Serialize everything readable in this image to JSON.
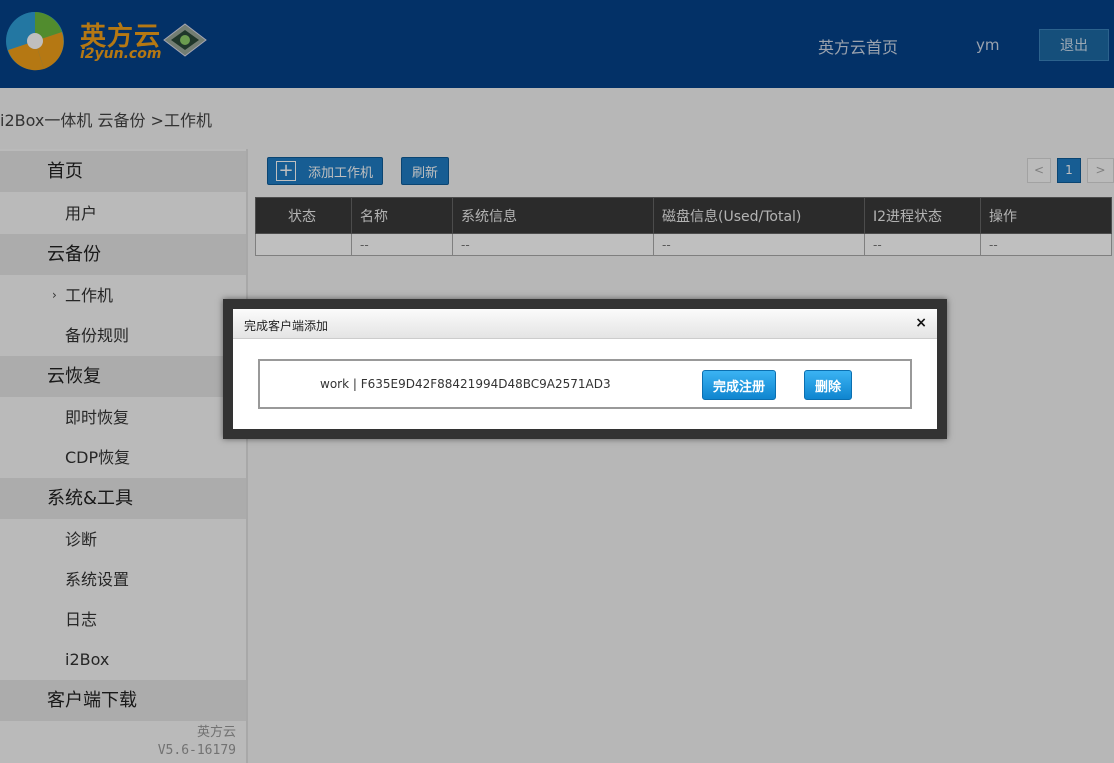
{
  "header": {
    "logo_text": "英方云",
    "logo_sub": "i2yun.com",
    "nav_home": "英方云首页",
    "user": "ym",
    "logout": "退出"
  },
  "breadcrumb": "i2Box一体机 云备份 >工作机",
  "sidebar": {
    "items": [
      {
        "label": "首页"
      },
      {
        "label": "用户"
      },
      {
        "label": "云备份"
      },
      {
        "label": "工作机"
      },
      {
        "label": "备份规则"
      },
      {
        "label": "云恢复"
      },
      {
        "label": "即时恢复"
      },
      {
        "label": "CDP恢复"
      },
      {
        "label": "系统&工具"
      },
      {
        "label": "诊断"
      },
      {
        "label": "系统设置"
      },
      {
        "label": "日志"
      },
      {
        "label": "i2Box"
      },
      {
        "label": "客户端下载"
      }
    ],
    "footer_brand": "英方云",
    "footer_version": "V5.6-16179"
  },
  "toolbar": {
    "add": "添加工作机",
    "refresh": "刷新"
  },
  "pager": {
    "prev": "<",
    "current": "1",
    "next": ">"
  },
  "table": {
    "headers": [
      "状态",
      "名称",
      "系统信息",
      "磁盘信息(Used/Total)",
      "I2进程状态",
      "操作"
    ],
    "row": [
      "",
      "--",
      "--",
      "--",
      "--",
      "--"
    ]
  },
  "modal": {
    "title": "完成客户端添加",
    "close": "×",
    "client": "work | F635E9D42F88421994D48BC9A2571AD3",
    "finish": "完成注册",
    "delete": "删除"
  },
  "colors": {
    "header_bg": "#04428a",
    "accent": "#1f7cc4",
    "logo": "#f2a11a"
  }
}
